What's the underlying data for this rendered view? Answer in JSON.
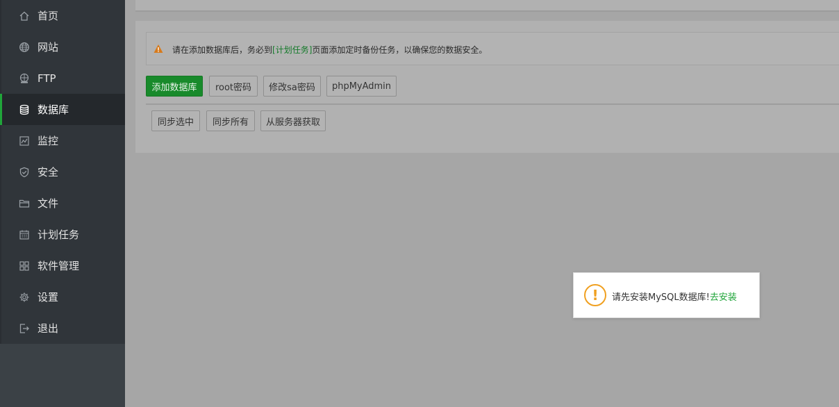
{
  "sidebar": {
    "items": [
      {
        "label": "首页",
        "icon": "home-icon"
      },
      {
        "label": "网站",
        "icon": "globe-icon"
      },
      {
        "label": "FTP",
        "icon": "ftp-icon"
      },
      {
        "label": "数据库",
        "icon": "database-icon",
        "active": true
      },
      {
        "label": "监控",
        "icon": "monitor-icon"
      },
      {
        "label": "安全",
        "icon": "shield-icon"
      },
      {
        "label": "文件",
        "icon": "folder-icon"
      },
      {
        "label": "计划任务",
        "icon": "calendar-icon"
      },
      {
        "label": "软件管理",
        "icon": "apps-grid-icon"
      },
      {
        "label": "设置",
        "icon": "gear-icon"
      },
      {
        "label": "退出",
        "icon": "logout-icon"
      }
    ]
  },
  "notice": {
    "prefix": "请在添加数据库后，务必到",
    "link": "[计划任务]",
    "suffix": "页面添加定时备份任务，以确保您的数据安全。"
  },
  "toolbar": {
    "add_database": "添加数据库",
    "root_password": "root密码",
    "change_sa_password": "修改sa密码",
    "phpmyadmin": "phpMyAdmin"
  },
  "sync_toolbar": {
    "sync_selected": "同步选中",
    "sync_all": "同步所有",
    "fetch_from_server": "从服务器获取"
  },
  "toast": {
    "message": "请先安装MySQL数据库!",
    "link": "去安装"
  },
  "colors": {
    "accent": "#20a53a",
    "warning": "#f0a020",
    "sidebar_bg": "#30353a"
  }
}
